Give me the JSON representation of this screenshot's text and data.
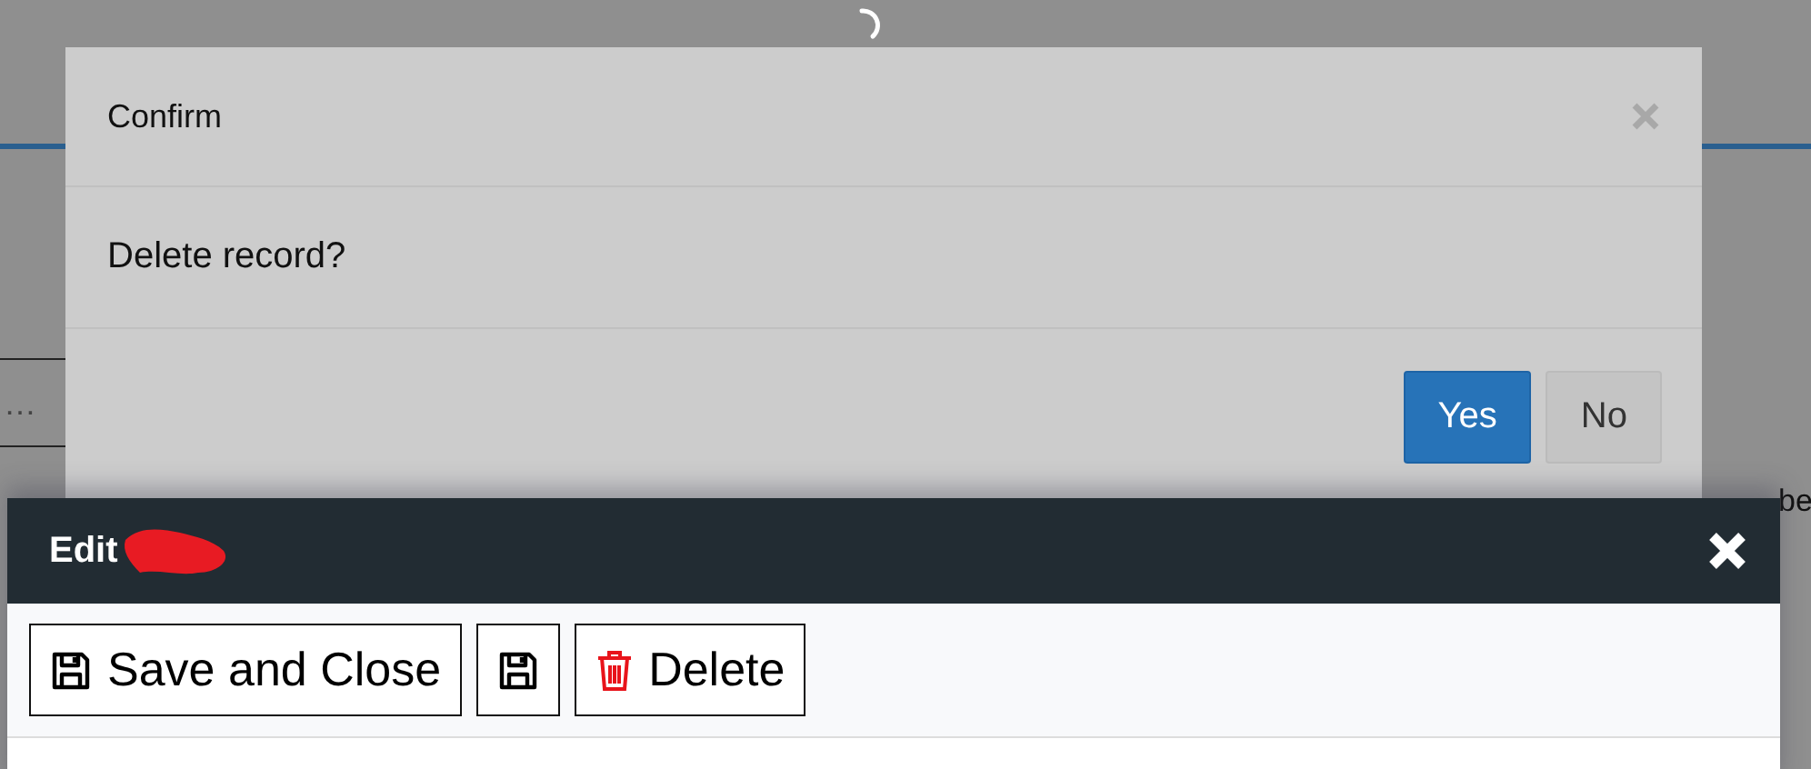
{
  "background": {
    "field_text": "…",
    "heading_fragment": "be"
  },
  "confirm_dialog": {
    "title": "Confirm",
    "message": "Delete record?",
    "buttons": [
      {
        "label": "Yes",
        "kind": "primary"
      },
      {
        "label": "No",
        "kind": "default"
      }
    ]
  },
  "edit_panel": {
    "title": "Edit",
    "toolbar": [
      {
        "kind": "save",
        "label": "Save and Close"
      },
      {
        "kind": "save"
      },
      {
        "kind": "delete",
        "label": "Delete"
      }
    ]
  }
}
